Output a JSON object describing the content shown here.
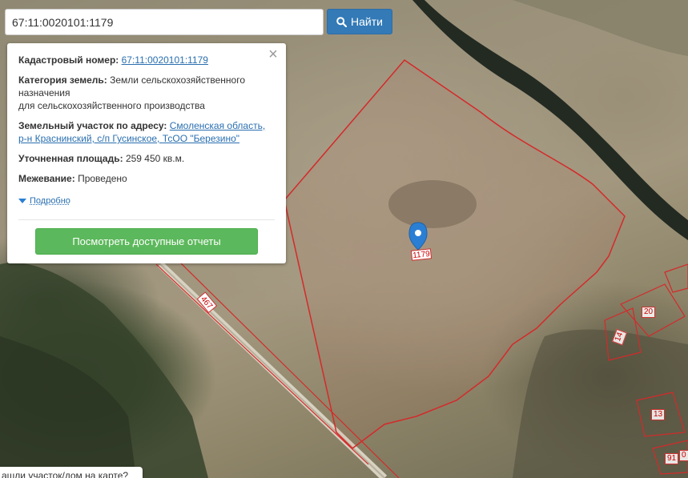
{
  "search": {
    "value": "67:11:0020101:1179",
    "button_label": "Найти"
  },
  "panel": {
    "cadastral_label": "Кадастровый номер:",
    "cadastral_value": "67:11:0020101:1179",
    "category_label": "Категория земель:",
    "category_value": "Земли сельскохозяйственного назначения",
    "category_value_line2": "для сельскохозяйственного производства",
    "address_label": "Земельный участок по адресу:",
    "address_value": "Смоленская область, р-н Краснинский, с/п Гусинское, ТсОО \"Березино\"",
    "area_label": "Уточненная площадь:",
    "area_value": "259 450 кв.м.",
    "survey_label": "Межевание:",
    "survey_value": "Проведено",
    "details_label": "Подробно",
    "reports_button": "Посмотреть доступные отчеты",
    "close": "×"
  },
  "map": {
    "marker_label": "1179",
    "road_label": "467",
    "plot_labels": [
      "20",
      "14",
      "13",
      "91",
      "0"
    ],
    "boundary_color": "#d42a2a",
    "marker_color": "#2a7fd4"
  },
  "hint": {
    "text": "ашли участок/дом на карте?"
  }
}
